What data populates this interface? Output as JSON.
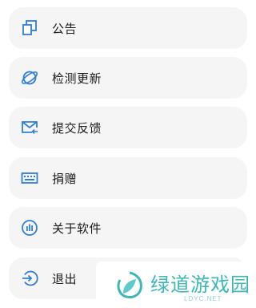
{
  "colors": {
    "accent": "#2f7fd6",
    "item_bg": "#f5f5f5",
    "text": "#1c1c1c",
    "watermark": "#3cb8b4"
  },
  "menu": {
    "items": [
      {
        "label": "公告",
        "icon": "announcement-icon"
      },
      {
        "label": "检测更新",
        "icon": "update-check-icon"
      },
      {
        "label": "提交反馈",
        "icon": "feedback-mail-icon"
      },
      {
        "label": "捐赠",
        "icon": "keyboard-icon"
      },
      {
        "label": "关于软件",
        "icon": "about-info-icon"
      },
      {
        "label": "退出",
        "icon": "exit-icon"
      }
    ]
  },
  "watermark": {
    "title": "绿道游戏园",
    "subtitle": "LDYC.NET"
  }
}
